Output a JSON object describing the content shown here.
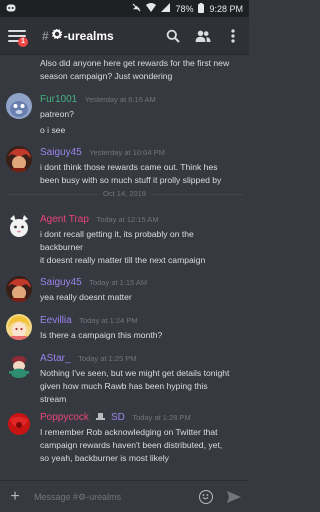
{
  "status_bar": {
    "battery": "78%",
    "time": "9:28 PM"
  },
  "header": {
    "badge": "1",
    "channel_name": "-urealms"
  },
  "messages": [
    {
      "type": "continuation",
      "lines": [
        "Also did anyone here get rewards for the first new",
        "season campaign? Just wondering"
      ]
    },
    {
      "type": "message",
      "username": "Fur1001",
      "username_color": "#43b581",
      "timestamp": "Yesterday at 6:16 AM",
      "avatar": "avatar-fur1001",
      "lines": [
        "patreon?",
        "o i see"
      ]
    },
    {
      "type": "message",
      "username": "Saiguy45",
      "username_color": "#9b84ec",
      "timestamp": "Yesterday at 10:04 PM",
      "avatar": "avatar-saiguy45",
      "lines": [
        "i dont think those rewards came out.  Think hes",
        "been busy with so much stuff it prolly slipped by"
      ]
    },
    {
      "type": "divider",
      "label": "Oct 14, 2019"
    },
    {
      "type": "message",
      "username": "Agent Trap",
      "username_color": "#e9467a",
      "timestamp": "Today at 12:15 AM",
      "avatar": "avatar-agent-trap",
      "lines": [
        "i dont recall getting it, its probably on the",
        "backburner",
        "it doesnt really matter till the next campaign"
      ]
    },
    {
      "type": "message",
      "username": "Saiguy45",
      "username_color": "#9b84ec",
      "timestamp": "Today at 1:15 AM",
      "avatar": "avatar-saiguy45",
      "lines": [
        "yea really doesnt matter"
      ]
    },
    {
      "type": "message",
      "username": "Eevillia",
      "username_color": "#9b84ec",
      "timestamp": "Today at 1:24 PM",
      "avatar": "avatar-eevillia",
      "lines": [
        "Is there a campaign this month?"
      ]
    },
    {
      "type": "message",
      "username": "AStar_",
      "username_color": "#9b84ec",
      "timestamp": "Today at 1:25 PM",
      "avatar": "avatar-astar",
      "lines": [
        "Nothing I've seen, but we might get details tonight",
        "given how much Rawb has been hyping this",
        "stream"
      ]
    },
    {
      "type": "message",
      "username": "Poppycock",
      "username_suffix": "SD",
      "username_color": "#e9467a",
      "timestamp": "Today at 1:28 PM",
      "avatar": "avatar-poppycock",
      "lines": [
        "I remember Rob acknowledging on Twitter that",
        "campaign rewards haven't been distributed, yet,",
        "so yeah, backburner is most likely"
      ]
    }
  ],
  "composer": {
    "placeholder": "Message #⚙-urealms"
  },
  "colors": {
    "background": "#36393f",
    "header": "#2f3136",
    "status_bar": "#1e2124",
    "text": "#dcddde",
    "muted": "#72767d"
  }
}
